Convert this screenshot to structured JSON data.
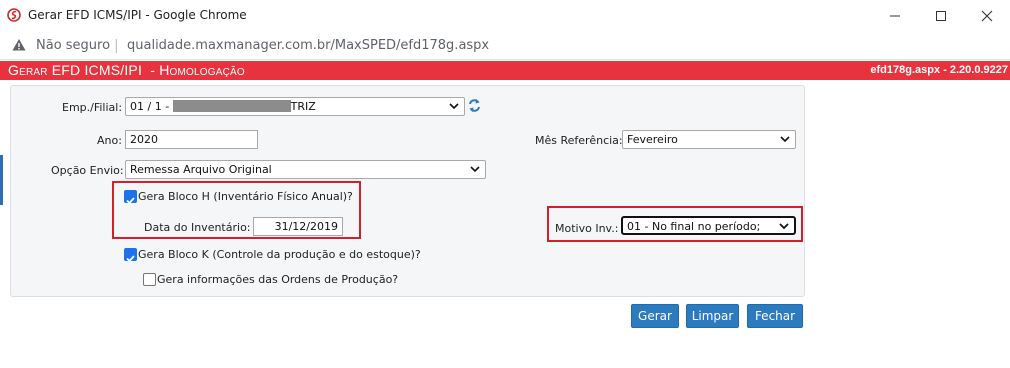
{
  "window": {
    "title": "Gerar EFD ICMS/IPI - Google Chrome"
  },
  "address_bar": {
    "security_label": "Não seguro",
    "url": "qualidade.maxmanager.com.br/MaxSPED/efd178g.aspx"
  },
  "header": {
    "title": "Gerar EFD ICMS/IPI  - Homologação",
    "version": "efd178g.aspx - 2.20.0.9227"
  },
  "form": {
    "empresa": {
      "label": "Emp./Filial:",
      "value_prefix": "01 / 1 - ",
      "value_suffix": "TRIZ"
    },
    "ano": {
      "label": "Ano:",
      "value": "2020"
    },
    "mes_referencia": {
      "label": "Mês Referência:",
      "value": "Fevereiro"
    },
    "opcao_envio": {
      "label": "Opção Envio:",
      "value": "Remessa Arquivo Original"
    },
    "bloco_h": {
      "label": "Gera Bloco H (Inventário Físico Anual)?",
      "checked": true
    },
    "data_inventario": {
      "label": "Data do Inventário:",
      "value": "31/12/2019"
    },
    "motivo_inv": {
      "label": "Motivo Inv.:",
      "value": "01 - No final no período;"
    },
    "bloco_k": {
      "label": "Gera Bloco K (Controle da produção e do estoque)?",
      "checked": true
    },
    "ordens_producao": {
      "label": "Gera informações das Ordens de Produção?",
      "checked": false
    }
  },
  "buttons": {
    "gerar": "Gerar",
    "limpar": "Limpar",
    "fechar": "Fechar"
  },
  "colors": {
    "header": "#e8333f",
    "button": "#2d7bbf",
    "highlight": "#d4202b",
    "checkbox": "#1a73e8"
  }
}
